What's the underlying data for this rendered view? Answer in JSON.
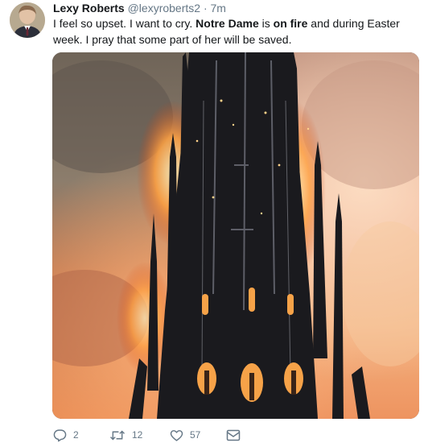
{
  "tweet": {
    "display_name": "Lexy Roberts",
    "handle": "@lexyroberts2",
    "separator": "·",
    "time": "7m",
    "text_parts": {
      "p1": "I feel so upset. I want to cry. ",
      "b1": "Notre Dame",
      "p2": " is ",
      "b2": "on fire",
      "p3": " and during Easter week. I pray that some part of her will be saved."
    },
    "media_icon": "notre-dame-spire-fire-photo"
  },
  "actions": {
    "reply": {
      "icon": "reply-icon",
      "count": "2"
    },
    "retweet": {
      "icon": "retweet-icon",
      "count": "12"
    },
    "like": {
      "icon": "heart-icon",
      "count": "57"
    },
    "message": {
      "icon": "envelope-icon"
    }
  },
  "colors": {
    "text": "#14171a",
    "muted": "#657786"
  }
}
